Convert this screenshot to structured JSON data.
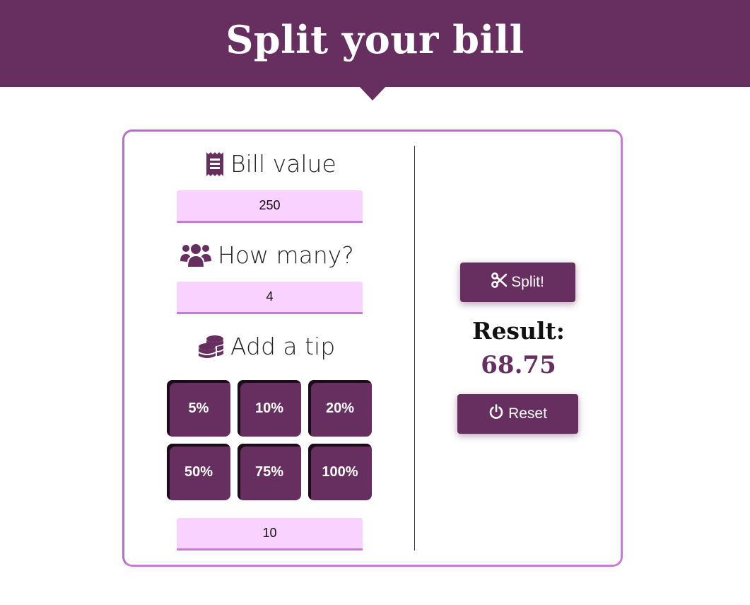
{
  "header": {
    "title": "Split your bill"
  },
  "form": {
    "bill": {
      "label": "Bill value",
      "value": "250",
      "icon": "receipt-icon"
    },
    "people": {
      "label": "How many?",
      "value": "4",
      "icon": "users-icon"
    },
    "tip": {
      "label": "Add a tip",
      "icon": "coins-icon",
      "options": [
        "5%",
        "10%",
        "20%",
        "50%",
        "75%",
        "100%"
      ],
      "custom_value": "10"
    }
  },
  "actions": {
    "split_label": "Split!",
    "split_icon": "scissors-icon",
    "reset_label": "Reset",
    "reset_icon": "power-icon"
  },
  "result": {
    "label": "Result:",
    "value": "68.75"
  },
  "colors": {
    "primary": "#672f60",
    "field_bg": "#fad2ff",
    "accent_border": "#c77bd9"
  }
}
